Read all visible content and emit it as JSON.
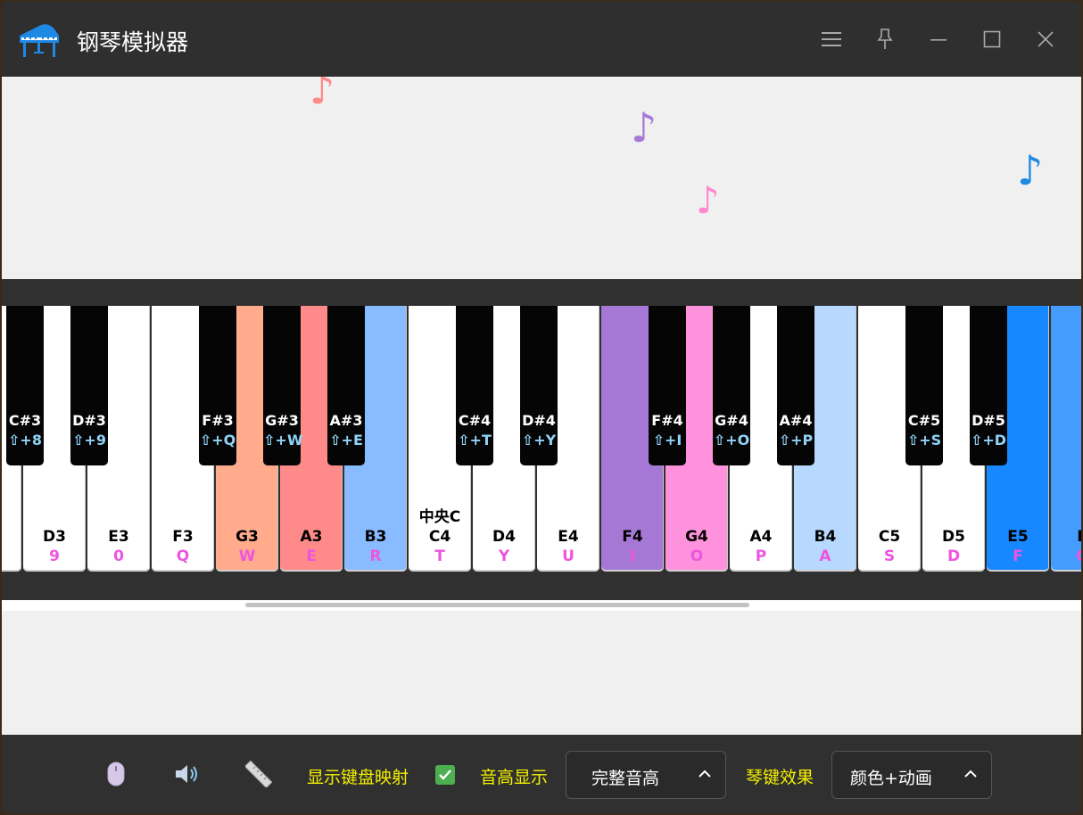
{
  "app": {
    "title": "钢琴模拟器"
  },
  "window_controls": [
    "menu-icon",
    "pin-icon",
    "minimize-icon",
    "maximize-icon",
    "close-icon"
  ],
  "notes": [
    {
      "color": "#ff8888",
      "glyph": "♪"
    },
    {
      "color": "#a67ad6",
      "glyph": "♪"
    },
    {
      "color": "#ff88cc",
      "glyph": "♪"
    },
    {
      "color": "#1e88e5",
      "glyph": "♪"
    }
  ],
  "white_keys": [
    {
      "note": "",
      "map": "",
      "color": "#ffffff"
    },
    {
      "note": "D3",
      "map": "9",
      "color": "#ffffff"
    },
    {
      "note": "E3",
      "map": "0",
      "color": "#ffffff"
    },
    {
      "note": "F3",
      "map": "Q",
      "color": "#ffffff"
    },
    {
      "note": "G3",
      "map": "W",
      "color": "#ffab8c"
    },
    {
      "note": "A3",
      "map": "E",
      "color": "#ff8a8a"
    },
    {
      "note": "B3",
      "map": "R",
      "color": "#88bbff"
    },
    {
      "note": "C4",
      "map": "T",
      "color": "#ffffff",
      "tag": "中央C"
    },
    {
      "note": "D4",
      "map": "Y",
      "color": "#ffffff"
    },
    {
      "note": "E4",
      "map": "U",
      "color": "#ffffff"
    },
    {
      "note": "F4",
      "map": "I",
      "color": "#a578d6"
    },
    {
      "note": "G4",
      "map": "O",
      "color": "#ff92dc"
    },
    {
      "note": "A4",
      "map": "P",
      "color": "#ffffff"
    },
    {
      "note": "B4",
      "map": "A",
      "color": "#b7d9ff"
    },
    {
      "note": "C5",
      "map": "S",
      "color": "#ffffff"
    },
    {
      "note": "D5",
      "map": "D",
      "color": "#ffffff"
    },
    {
      "note": "E5",
      "map": "F",
      "color": "#1788ff"
    },
    {
      "note": "F",
      "map": "G",
      "color": "#459cff"
    }
  ],
  "black_keys": [
    {
      "note": "C#3",
      "map": "⇧+8"
    },
    {
      "note": "D#3",
      "map": "⇧+9"
    },
    {
      "note": "F#3",
      "map": "⇧+Q"
    },
    {
      "note": "G#3",
      "map": "⇧+W"
    },
    {
      "note": "A#3",
      "map": "⇧+E"
    },
    {
      "note": "C#4",
      "map": "⇧+T"
    },
    {
      "note": "D#4",
      "map": "⇧+Y"
    },
    {
      "note": "F#4",
      "map": "⇧+I"
    },
    {
      "note": "G#4",
      "map": "⇧+O"
    },
    {
      "note": "A#4",
      "map": "⇧+P"
    },
    {
      "note": "C#5",
      "map": "⇧+S"
    },
    {
      "note": "D#5",
      "map": "⇧+D"
    }
  ],
  "toolbar": {
    "icons": [
      "mouse-icon",
      "speaker-icon",
      "ruler-icon"
    ],
    "show_mapping_label": "显示键盘映射",
    "show_mapping_checked": true,
    "pitch_label": "音高显示",
    "pitch_value": "完整音高",
    "effect_label": "琴键效果",
    "effect_value": "颜色+动画"
  },
  "colors": {
    "accent": "#1e88e5",
    "label_yellow": "#f4f000",
    "map_pink": "#ee55dd",
    "map_cyan": "#8fd2f6"
  }
}
